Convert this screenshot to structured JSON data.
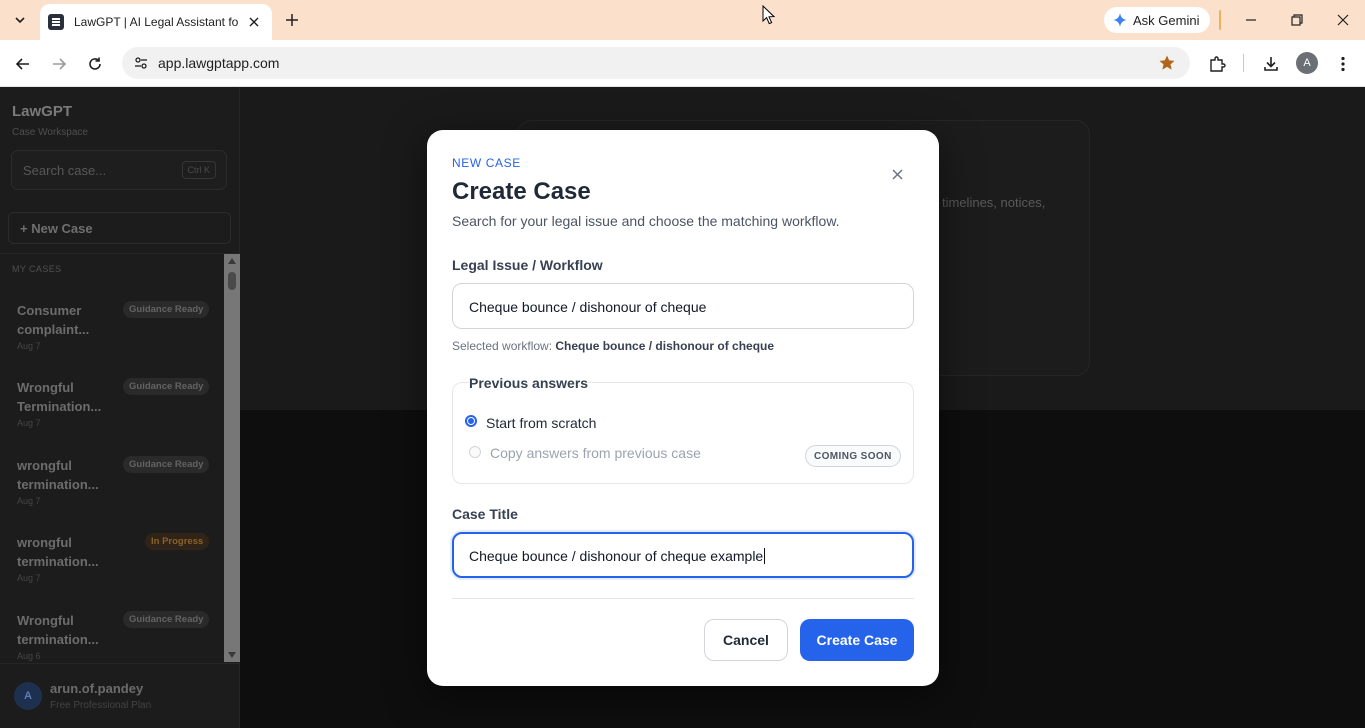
{
  "browser": {
    "tab_title": "LawGPT | AI Legal Assistant for Indian Law",
    "url": "app.lawgptapp.com",
    "gemini_label": "Ask Gemini",
    "profile_initial": "A"
  },
  "sidebar": {
    "brand": "LawGPT",
    "subtitle": "Case Workspace",
    "search_placeholder": "Search case...",
    "search_shortcut": "Ctrl K",
    "new_case_label": "+ New Case",
    "section_label": "MY CASES",
    "cases": [
      {
        "title": "Consumer complaint...",
        "date": "Aug 7",
        "status": "Guidance Ready"
      },
      {
        "title": "Wrongful Termination...",
        "date": "Aug 7",
        "status": "Guidance Ready"
      },
      {
        "title": "wrongful termination...",
        "date": "Aug 7",
        "status": "Guidance Ready"
      },
      {
        "title": "wrongful termination...",
        "date": "Aug 7",
        "status": "In Progress"
      },
      {
        "title": "Wrongful termination...",
        "date": "Aug 6",
        "status": "Guidance Ready"
      }
    ],
    "user": {
      "initial": "A",
      "name": "arun.of.pandey",
      "plan": "Free Professional Plan"
    }
  },
  "background": {
    "card_text": "timelines, notices,"
  },
  "modal": {
    "kicker": "NEW CASE",
    "title": "Create Case",
    "subtitle": "Search for your legal issue and choose the matching workflow.",
    "workflow_label": "Legal Issue / Workflow",
    "workflow_value": "Cheque bounce / dishonour of cheque",
    "selected_prefix": "Selected workflow:",
    "selected_value": "Cheque bounce / dishonour of cheque",
    "previous_legend": "Previous answers",
    "option_scratch": "Start from scratch",
    "option_copy": "Copy answers from previous case",
    "coming_soon": "COMING SOON",
    "case_title_label": "Case Title",
    "case_title_value": "Cheque bounce / dishonour of cheque example",
    "cancel_label": "Cancel",
    "create_label": "Create Case"
  },
  "colors": {
    "accent": "#2563eb",
    "tabbar": "#fbe1cb",
    "in_progress": "#8a6228"
  }
}
